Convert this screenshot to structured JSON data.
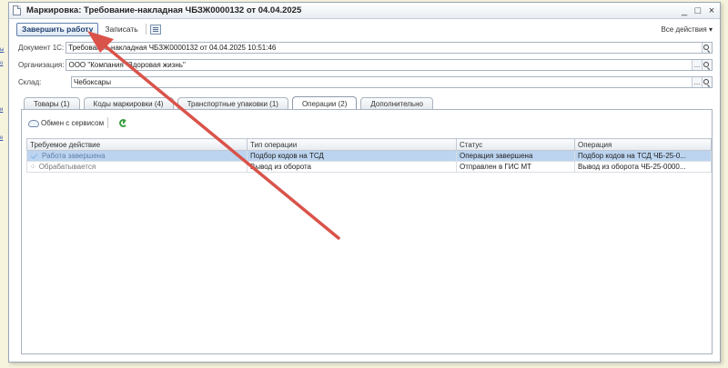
{
  "window": {
    "title": "Маркировка: Требование-накладная ЧБЗЖ0000132 от 04.04.2025",
    "controls": [
      "_",
      "□",
      "×"
    ]
  },
  "toolbar": {
    "finish_label": "Завершить работу",
    "save_label": "Записать",
    "all_actions_label": "Все действия ▾"
  },
  "fields": {
    "document": {
      "label": "Документ 1С:",
      "value": "Требование-накладная ЧБЗЖ0000132 от 04.04.2025 10:51:46"
    },
    "organization": {
      "label": "Организация:",
      "value": "ООО \"Компания \"Здоровая жизнь\""
    },
    "warehouse": {
      "label": "Склад:",
      "value": "Чебоксары"
    },
    "select_button": "...",
    "search_icon": "search-icon"
  },
  "tabs": [
    {
      "label": "Товары (1)"
    },
    {
      "label": "Коды маркировки (4)"
    },
    {
      "label": "Транспортные упаковки (1)"
    },
    {
      "label": "Операции (2)",
      "active": true
    },
    {
      "label": "Дополнительно"
    }
  ],
  "operations": {
    "exchange_label": "Обмен с сервисом",
    "columns": [
      "Требуемое действие",
      "Тип операции",
      "Статус",
      "Операция"
    ],
    "rows": [
      {
        "action": "Работа завершена",
        "type": "Подбор кодов на ТСД",
        "status": "Операция завершена",
        "operation": "Подбор кодов на ТСД ЧБ-25-0...",
        "icon": "check-icon",
        "selected": true
      },
      {
        "action": "Обрабатывается",
        "type": "Вывод из оборота",
        "status": "Отправлен в ГИС МТ",
        "operation": "Вывод из оборота ЧБ-25-0000...",
        "icon": "spinner-icon",
        "selected": false
      }
    ]
  },
  "colors": {
    "arrow": "#d9534a",
    "selection": "#bcd4ef",
    "accent": "#1e3f6e"
  }
}
